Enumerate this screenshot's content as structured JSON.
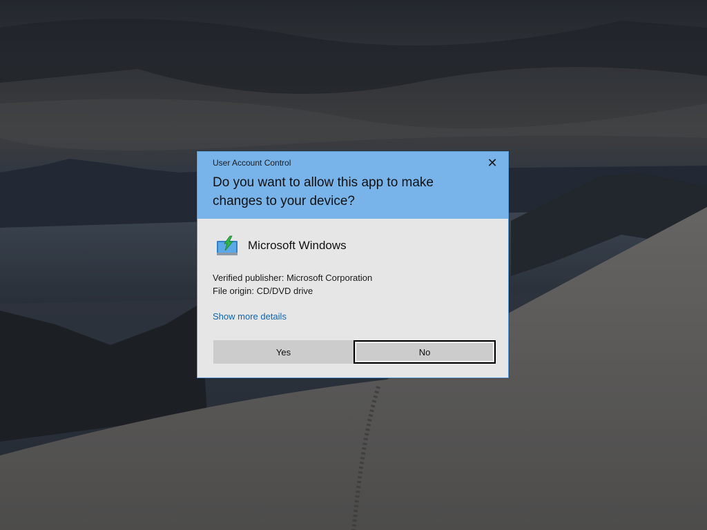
{
  "dialog": {
    "title": "User Account Control",
    "close_glyph": "✕",
    "question": "Do you want to allow this app to make changes to your device?",
    "app_name": "Microsoft Windows",
    "app_icon": "windows-setup-icon",
    "publisher_line": "Verified publisher: Microsoft Corporation",
    "origin_line": "File origin: CD/DVD drive",
    "details_link": "Show more details",
    "yes_label": "Yes",
    "no_label": "No",
    "focused_button": "No"
  },
  "colors": {
    "header": "#78b4ea",
    "body": "#e6e6e6",
    "link": "#0a64b4",
    "button": "#cccccc"
  }
}
